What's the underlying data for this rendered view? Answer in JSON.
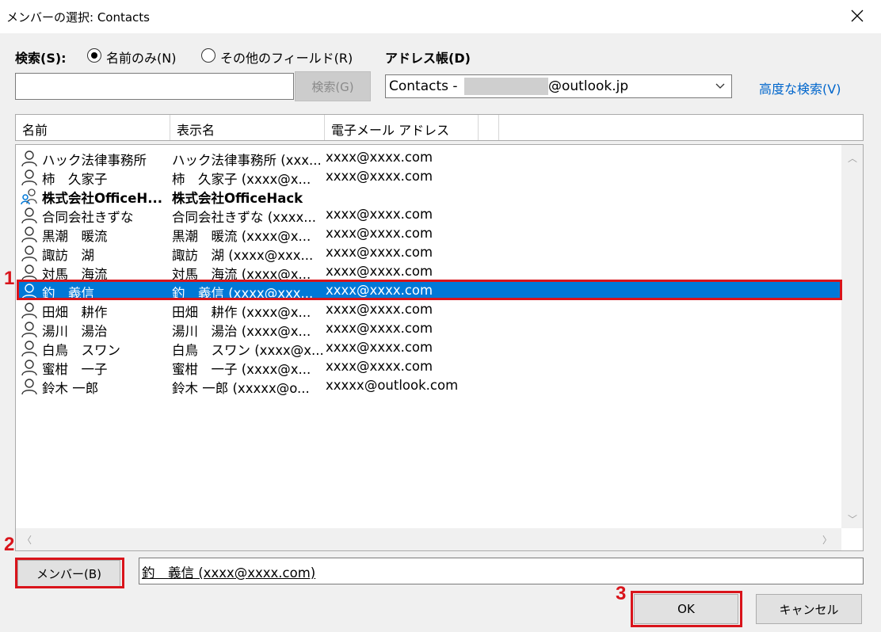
{
  "window": {
    "title": "メンバーの選択: Contacts"
  },
  "search": {
    "label": "検索(S):",
    "option_name_only": "名前のみ(N)",
    "option_other_fields": "その他のフィールド(R)",
    "input_value": "",
    "search_button": "検索(G)"
  },
  "addressbook": {
    "label": "アドレス帳(D)",
    "selected_prefix": "Contacts - ",
    "selected_suffix": "@outlook.jp",
    "advanced_link": "高度な検索(V)"
  },
  "columns": [
    "名前",
    "表示名",
    "電子メール アドレス"
  ],
  "contacts": [
    {
      "name": "ハック法律事務所",
      "display": "ハック法律事務所 (xxx...",
      "email": "xxxx@xxxx.com",
      "type": "person"
    },
    {
      "name": "柿　久家子",
      "display": "柿　久家子 (xxxx@x...",
      "email": "xxxx@xxxx.com",
      "type": "person"
    },
    {
      "name": "株式会社OfficeH...",
      "display": "株式会社OfficeHack",
      "email": "",
      "type": "group"
    },
    {
      "name": "合同会社きずな",
      "display": "合同会社きずな (xxxx...",
      "email": "xxxx@xxxx.com",
      "type": "person"
    },
    {
      "name": "黒潮　暖流",
      "display": "黒潮　暖流 (xxxx@x...",
      "email": "xxxx@xxxx.com",
      "type": "person"
    },
    {
      "name": "諏訪　湖",
      "display": "諏訪　湖 (xxxx@xxx...",
      "email": "xxxx@xxxx.com",
      "type": "person"
    },
    {
      "name": "対馬　海流",
      "display": "対馬　海流 (xxxx@x...",
      "email": "xxxx@xxxx.com",
      "type": "person"
    },
    {
      "name": "釣　義信",
      "display": "釣　義信 (xxxx@xxx...",
      "email": "xxxx@xxxx.com",
      "type": "person",
      "selected": true
    },
    {
      "name": "田畑　耕作",
      "display": "田畑　耕作 (xxxx@x...",
      "email": "xxxx@xxxx.com",
      "type": "person"
    },
    {
      "name": "湯川　湯治",
      "display": "湯川　湯治 (xxxx@x...",
      "email": "xxxx@xxxx.com",
      "type": "person"
    },
    {
      "name": "白鳥　スワン",
      "display": "白鳥　スワン (xxxx@x...",
      "email": "xxxx@xxxx.com",
      "type": "person"
    },
    {
      "name": "蜜柑　一子",
      "display": "蜜柑　一子 (xxxx@x...",
      "email": "xxxx@xxxx.com",
      "type": "person"
    },
    {
      "name": "鈴木 一郎",
      "display": "鈴木 一郎 (xxxxx@o...",
      "email": "xxxxx@outlook.com",
      "type": "person"
    }
  ],
  "members": {
    "button": "メンバー(B)",
    "value": "釣　義信 (xxxx@xxxx.com)"
  },
  "footer": {
    "ok": "OK",
    "cancel": "キャンセル"
  },
  "annotations": {
    "step1": "1",
    "step2": "2",
    "step3": "3"
  },
  "colors": {
    "selection": "#0078d7",
    "annotation": "#d9141b",
    "link": "#0066cc"
  }
}
